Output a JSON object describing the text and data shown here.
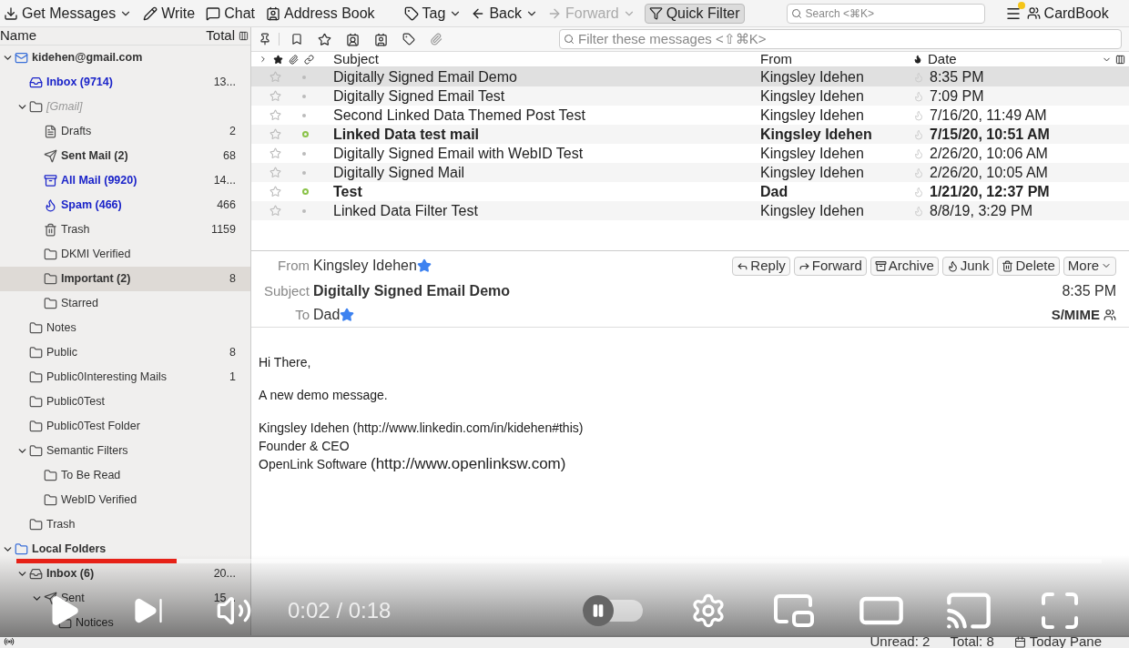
{
  "toolbar": {
    "buttons": [
      {
        "label": "Get Messages",
        "menu": true,
        "disabled": false
      },
      {
        "label": "Write",
        "menu": false,
        "disabled": false
      },
      {
        "label": "Chat",
        "menu": false,
        "disabled": false
      },
      {
        "label": "Address Book",
        "menu": false,
        "disabled": false
      }
    ],
    "nav": [
      {
        "label": "Tag",
        "menu": true,
        "disabled": false
      },
      {
        "label": "Back",
        "menu": true,
        "disabled": false
      },
      {
        "label": "Forward",
        "menu": true,
        "disabled": true
      }
    ],
    "quick_filter": {
      "label": "Quick Filter",
      "on": true
    },
    "search": {
      "placeholder": "Search <⌘K>"
    },
    "cardbook": {
      "label": "CardBook"
    }
  },
  "folder_pane": {
    "columns": [
      "Name",
      "Total"
    ],
    "tree": [
      {
        "name": "kidehen@gmail.com",
        "kind": "account",
        "selected": false,
        "expanded": true,
        "children": [
          {
            "name": "Inbox (9714)",
            "kind": "inbox",
            "total": "13...",
            "unread": true,
            "new": true,
            "selected": false
          },
          {
            "name": "[Gmail]",
            "kind": "virtual",
            "unread": false,
            "new": false,
            "selected": false,
            "expanded": true,
            "children": [
              {
                "name": "Drafts",
                "kind": "drafts",
                "total": "2",
                "unread": false,
                "new": false,
                "selected": false
              },
              {
                "name": "Sent Mail (2)",
                "kind": "sent",
                "total": "68",
                "unread": true,
                "new": false,
                "selected": false
              },
              {
                "name": "All Mail (9920)",
                "kind": "archive",
                "total": "14...",
                "unread": true,
                "new": true,
                "selected": false
              },
              {
                "name": "Spam (466)",
                "kind": "spam",
                "total": "466",
                "unread": true,
                "new": true,
                "selected": false
              },
              {
                "name": "Trash",
                "kind": "trash",
                "total": "1159",
                "unread": false,
                "new": false,
                "selected": false
              },
              {
                "name": "DKMI Verified",
                "kind": "folder",
                "unread": false,
                "new": false,
                "selected": false
              },
              {
                "name": "Important (2)",
                "kind": "folder",
                "total": "8",
                "unread": true,
                "new": false,
                "selected": true
              },
              {
                "name": "Starred",
                "kind": "folder",
                "unread": false,
                "new": false,
                "selected": false
              }
            ]
          },
          {
            "name": "Notes",
            "kind": "folder",
            "unread": false,
            "new": false,
            "selected": false
          },
          {
            "name": "Public",
            "kind": "folder",
            "total": "8",
            "unread": false,
            "new": false,
            "selected": false
          },
          {
            "name": "Public0Interesting Mails",
            "kind": "folder",
            "total": "1",
            "unread": false,
            "new": false,
            "selected": false
          },
          {
            "name": "Public0Test",
            "kind": "folder",
            "unread": false,
            "new": false,
            "selected": false
          },
          {
            "name": "Public0Test Folder",
            "kind": "folder",
            "unread": false,
            "new": false,
            "selected": false
          },
          {
            "name": "Semantic Filters",
            "kind": "folder",
            "unread": false,
            "new": false,
            "selected": false,
            "expanded": true,
            "children": [
              {
                "name": "To Be Read",
                "kind": "folder",
                "unread": false,
                "new": false,
                "selected": false
              },
              {
                "name": "WebID Verified",
                "kind": "folder",
                "unread": false,
                "new": false,
                "selected": false
              }
            ]
          },
          {
            "name": "Trash",
            "kind": "folder",
            "unread": false,
            "new": false,
            "selected": false
          }
        ]
      },
      {
        "name": "Local Folders",
        "kind": "local",
        "selected": false,
        "expanded": true,
        "children": [
          {
            "name": "Inbox (6)",
            "kind": "inbox",
            "total": "20...",
            "unread": true,
            "new": false,
            "selected": false,
            "expanded": true,
            "children": [
              {
                "name": "Sent",
                "kind": "sent",
                "total": "15...",
                "unread": false,
                "new": false,
                "selected": false,
                "expanded": true,
                "children": [
                  {
                    "name": "Notices",
                    "kind": "folder",
                    "unread": false,
                    "new": false,
                    "selected": false
                  }
                ]
              }
            ]
          }
        ]
      }
    ]
  },
  "quick_filter_bar": {
    "placeholder": "Filter these messages <⇧⌘K>"
  },
  "message_list": {
    "columns": [
      "Subject",
      "From",
      "Date"
    ],
    "rows": [
      {
        "subject": "Digitally Signed Email Demo",
        "from": "Kingsley Idehen",
        "date": "8:35 PM",
        "unread": false,
        "starred": false,
        "selected": true
      },
      {
        "subject": "Digitally Signed Email Test",
        "from": "Kingsley Idehen",
        "date": "7:09 PM",
        "unread": false,
        "starred": false,
        "selected": false
      },
      {
        "subject": "Second Linked Data Themed Post Test",
        "from": "Kingsley Idehen",
        "date": "7/16/20, 11:49 AM",
        "unread": false,
        "starred": false,
        "selected": false
      },
      {
        "subject": "Linked Data test mail",
        "from": "Kingsley Idehen",
        "date": "7/15/20, 10:51 AM",
        "unread": true,
        "starred": false,
        "selected": false
      },
      {
        "subject": "Digitally Signed Email with WebID Test",
        "from": "Kingsley Idehen",
        "date": "2/26/20, 10:06 AM",
        "unread": false,
        "starred": false,
        "selected": false
      },
      {
        "subject": "Digitally Signed Mail",
        "from": "Kingsley Idehen",
        "date": "2/26/20, 10:05 AM",
        "unread": false,
        "starred": false,
        "selected": false
      },
      {
        "subject": "Test",
        "from": "Dad",
        "date": "1/21/20, 12:37 PM",
        "unread": true,
        "starred": false,
        "selected": false
      },
      {
        "subject": "Linked Data Filter Test",
        "from": "Kingsley Idehen",
        "date": "8/8/19, 3:29 PM",
        "unread": false,
        "starred": false,
        "selected": false
      }
    ]
  },
  "message_header": {
    "from_label": "From",
    "from": "Kingsley Idehen",
    "subject_label": "Subject",
    "subject": "Digitally Signed Email Demo",
    "to_label": "To",
    "to": "Dad",
    "time": "8:35 PM",
    "security": "S/MIME",
    "actions": [
      "Reply",
      "Forward",
      "Archive",
      "Junk",
      "Delete",
      "More"
    ]
  },
  "message_body": {
    "paragraphs": [
      [
        [
          {
            "text": "Hi There,",
            "large": false
          }
        ]
      ],
      [
        [
          {
            "text": "A new demo message.",
            "large": false
          }
        ]
      ],
      [
        [
          {
            "text": "Kingsley Idehen (http://www.linkedin.com/in/kidehen#this)",
            "large": false
          }
        ],
        [
          {
            "text": "Founder & CEO",
            "large": false
          }
        ],
        [
          {
            "text": "OpenLink Software ",
            "large": false
          },
          {
            "text": "(http://www.openlinksw.com)",
            "large": true
          }
        ]
      ]
    ]
  },
  "status_bar": {
    "unread": "Unread: 2",
    "total": "Total: 8",
    "today_pane": "Today Pane"
  },
  "video_player": {
    "progress": {
      "level": 0.148
    },
    "time": "0:02 / 0:18",
    "autoplay": {
      "on": false
    }
  }
}
